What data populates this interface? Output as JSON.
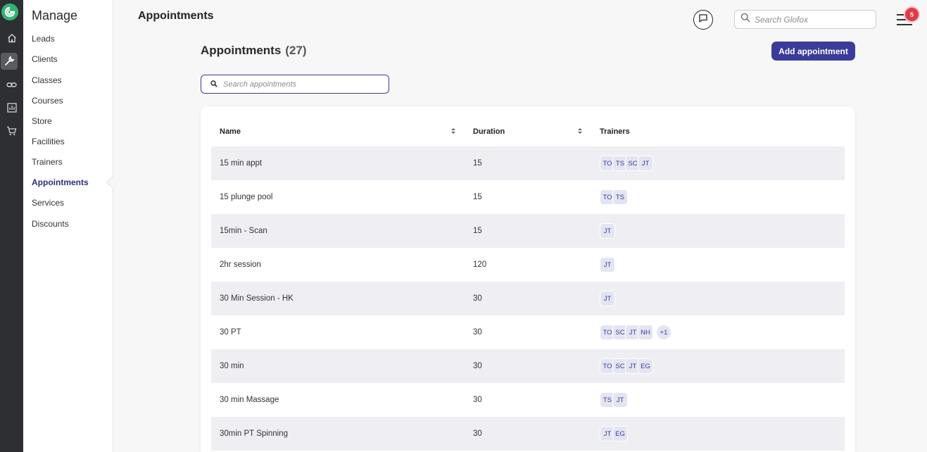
{
  "rail": {
    "icons": [
      "logo-icon",
      "home-icon",
      "wrench-icon",
      "link-icon",
      "chart-icon",
      "cart-icon"
    ]
  },
  "sidebar": {
    "title": "Manage",
    "items": [
      {
        "label": "Leads"
      },
      {
        "label": "Clients"
      },
      {
        "label": "Classes"
      },
      {
        "label": "Courses"
      },
      {
        "label": "Store"
      },
      {
        "label": "Facilities"
      },
      {
        "label": "Trainers"
      },
      {
        "label": "Appointments",
        "active": true
      },
      {
        "label": "Services"
      },
      {
        "label": "Discounts"
      }
    ]
  },
  "header": {
    "title": "Appointments",
    "search_placeholder": "Search Glofox",
    "notification_count": "5"
  },
  "main": {
    "title": "Appointments",
    "count": "(27)",
    "add_button": "Add appointment",
    "search_placeholder": "Search appointments",
    "columns": [
      "Name",
      "Duration",
      "Trainers"
    ],
    "rows": [
      {
        "name": "15 min appt",
        "duration": "15",
        "trainers": [
          "TO",
          "TS",
          "SC",
          "JT"
        ]
      },
      {
        "name": "15 plunge pool",
        "duration": "15",
        "trainers": [
          "TO",
          "TS"
        ]
      },
      {
        "name": "15min - Scan",
        "duration": "15",
        "trainers": [
          "JT"
        ]
      },
      {
        "name": "2hr session",
        "duration": "120",
        "trainers": [
          "JT"
        ]
      },
      {
        "name": "30 Min Session - HK",
        "duration": "30",
        "trainers": [
          "JT"
        ]
      },
      {
        "name": "30 PT",
        "duration": "30",
        "trainers": [
          "TO",
          "SC",
          "JT",
          "NH"
        ],
        "more": "+1"
      },
      {
        "name": "30 min",
        "duration": "30",
        "trainers": [
          "TO",
          "SC",
          "JT",
          "EG"
        ]
      },
      {
        "name": "30 min Massage",
        "duration": "30",
        "trainers": [
          "TS",
          "JT"
        ]
      },
      {
        "name": "30min PT Spinning",
        "duration": "30",
        "trainers": [
          "JT",
          "EG"
        ]
      }
    ]
  },
  "colors": {
    "accent": "#3a3c9a",
    "brand": "#2fb573",
    "rail": "#2e2f33",
    "notification": "#e03a48"
  }
}
